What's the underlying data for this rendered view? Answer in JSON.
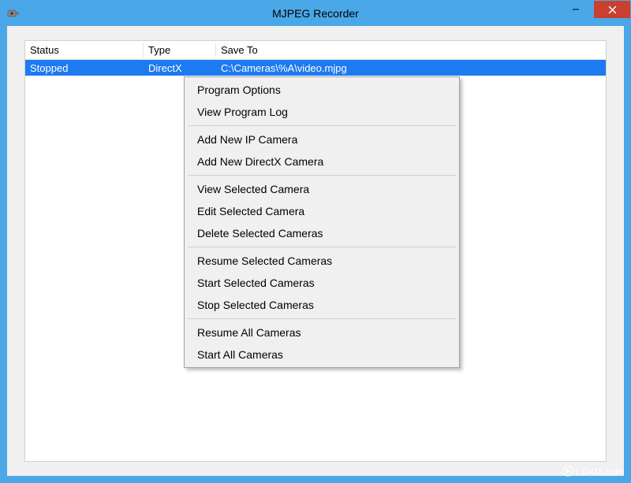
{
  "window": {
    "title": "MJPEG Recorder"
  },
  "table": {
    "headers": {
      "status": "Status",
      "type": "Type",
      "save_to": "Save To"
    },
    "rows": [
      {
        "status": "Stopped",
        "type": "DirectX",
        "save_to": "C:\\Cameras\\%A\\video.mjpg"
      }
    ]
  },
  "context_menu": {
    "items": [
      {
        "label": "Program Options"
      },
      {
        "label": "View Program Log"
      },
      {
        "sep": true
      },
      {
        "label": "Add New IP Camera"
      },
      {
        "label": "Add New DirectX Camera"
      },
      {
        "sep": true
      },
      {
        "label": "View Selected Camera"
      },
      {
        "label": "Edit Selected Camera"
      },
      {
        "label": "Delete Selected Cameras"
      },
      {
        "sep": true
      },
      {
        "label": "Resume Selected Cameras"
      },
      {
        "label": "Start Selected Cameras"
      },
      {
        "label": "Stop Selected Cameras"
      },
      {
        "sep": true
      },
      {
        "label": "Resume All Cameras"
      },
      {
        "label": "Start All Cameras"
      }
    ]
  },
  "watermark": "LO4D.com"
}
